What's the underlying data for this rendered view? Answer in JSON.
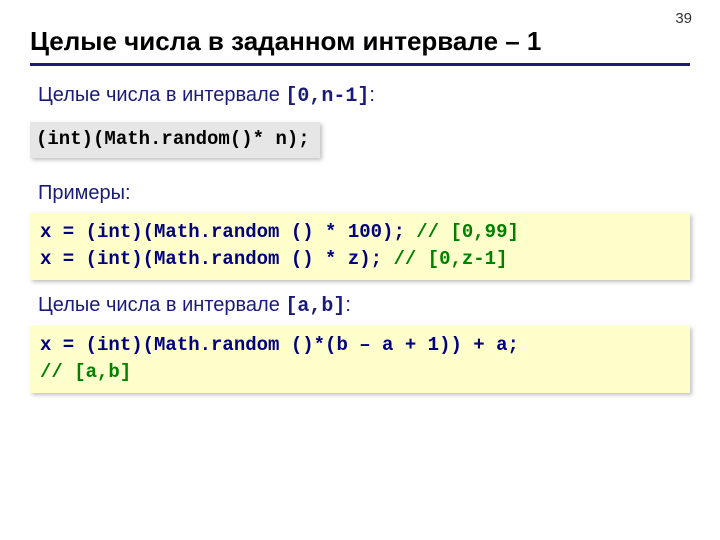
{
  "page_number": "39",
  "title": "Целые числа в заданном интервале – 1",
  "line1_prefix": "Целые числа в интервале ",
  "line1_mono": "[0,n-1]",
  "line1_suffix": ":",
  "code1": "(int)(Math.random()* n);",
  "line2": "Примеры:",
  "code2_line1_code": "x = (int)(Math.random () * 100); ",
  "code2_line1_comment": "// [0,99]",
  "code2_line2_code": "x = (int)(Math.random () * z);   ",
  "code2_line2_comment": "// [0,z-1]",
  "line3_prefix": "Целые числа в интервале ",
  "line3_mono": "[a,b]",
  "line3_suffix": ":",
  "code3_line1": "x = (int)(Math.random ()*(b – a + 1)) + a;",
  "code3_line2": "// [a,b]"
}
